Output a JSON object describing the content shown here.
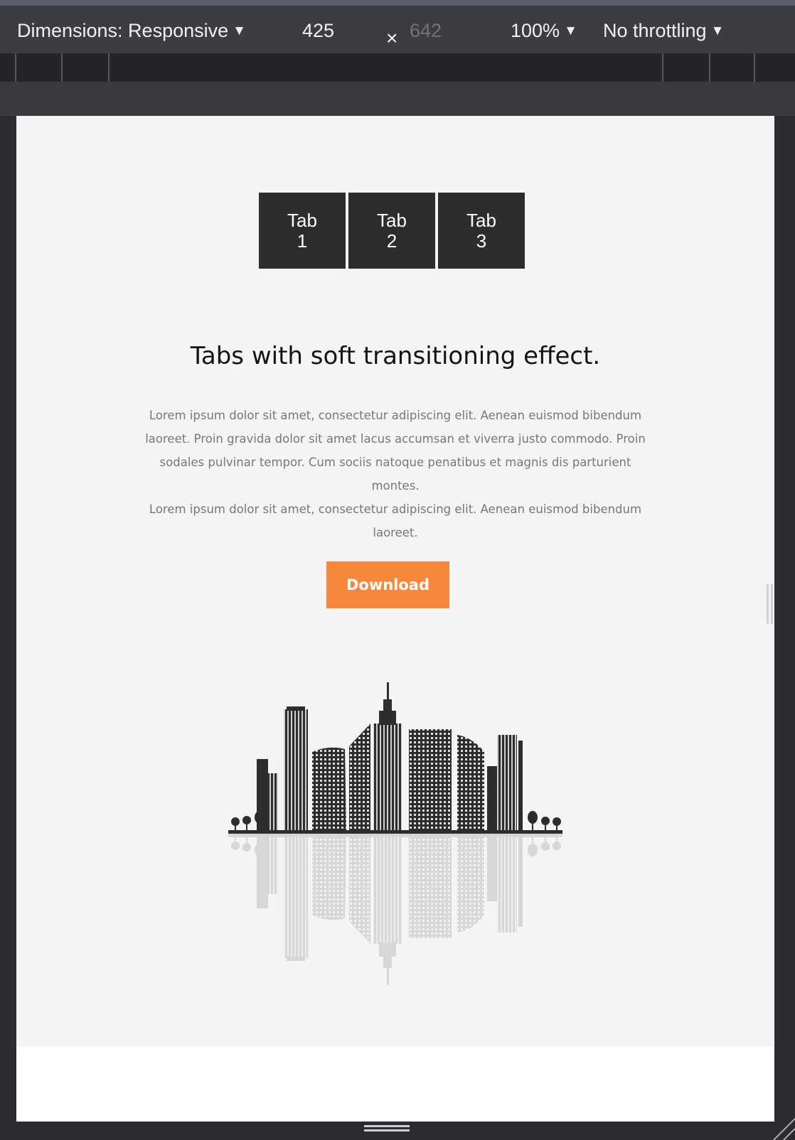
{
  "devtools": {
    "dimensions_label": "Dimensions: Responsive",
    "width_value": "425",
    "times_symbol": "×",
    "height_value": "642",
    "zoom_label": "100%",
    "throttle_label": "No throttling",
    "caret_icon": "▼"
  },
  "page": {
    "tabs": [
      {
        "line1": "Tab",
        "line2": "1"
      },
      {
        "line1": "Tab",
        "line2": "2"
      },
      {
        "line1": "Tab",
        "line2": "3"
      }
    ],
    "headline": "Tabs with soft transitioning effect.",
    "paragraph_1": "Lorem ipsum dolor sit amet, consectetur adipiscing elit. Aenean euismod bibendum laoreet. Proin gravida dolor sit amet lacus accumsan et viverra justo commodo. Proin sodales pulvinar tempor. Cum sociis natoque penatibus et magnis dis parturient montes.",
    "paragraph_2": "Lorem ipsum dolor sit amet, consectetur adipiscing elit. Aenean euismod bibendum laoreet.",
    "download_label": "Download",
    "illustration": "city-skyline-icon"
  },
  "colors": {
    "accent": "#f7873a",
    "tab_bg": "#2d2d2d",
    "page_bg": "#f4f4f4",
    "devtools_bg": "#3c3d41"
  }
}
